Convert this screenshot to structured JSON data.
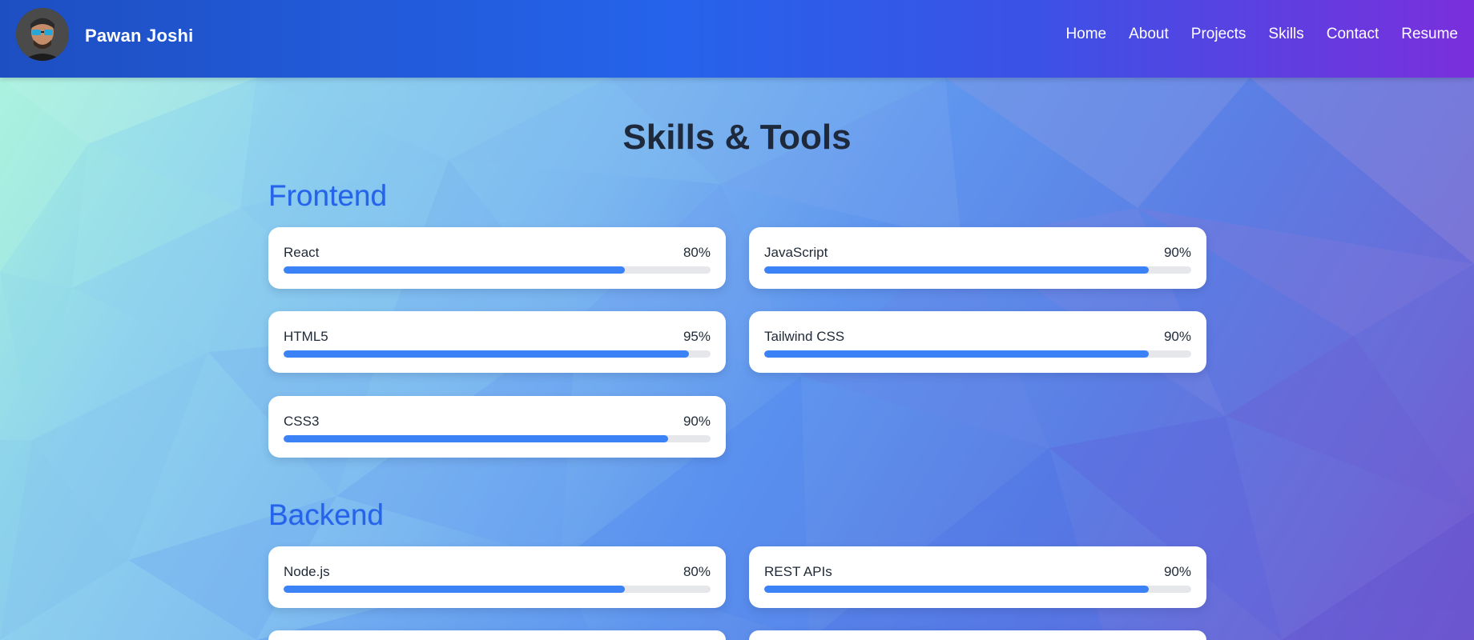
{
  "header": {
    "name": "Pawan Joshi",
    "nav": [
      "Home",
      "About",
      "Projects",
      "Skills",
      "Contact",
      "Resume"
    ]
  },
  "main": {
    "title": "Skills & Tools",
    "sections": [
      {
        "title": "Frontend",
        "skills": [
          {
            "name": "React",
            "percent": "80%",
            "level": 80
          },
          {
            "name": "JavaScript",
            "percent": "90%",
            "level": 90
          },
          {
            "name": "HTML5",
            "percent": "95%",
            "level": 95
          },
          {
            "name": "Tailwind CSS",
            "percent": "90%",
            "level": 90
          },
          {
            "name": "CSS3",
            "percent": "90%",
            "level": 90
          }
        ]
      },
      {
        "title": "Backend",
        "skills": [
          {
            "name": "Node.js",
            "percent": "80%",
            "level": 80
          },
          {
            "name": "REST APIs",
            "percent": "90%",
            "level": 90
          }
        ]
      }
    ]
  },
  "colors": {
    "accent": "#2563eb",
    "bar_fill": "#3b82f6",
    "bar_track": "#e5e7eb",
    "title": "#1e293b"
  }
}
